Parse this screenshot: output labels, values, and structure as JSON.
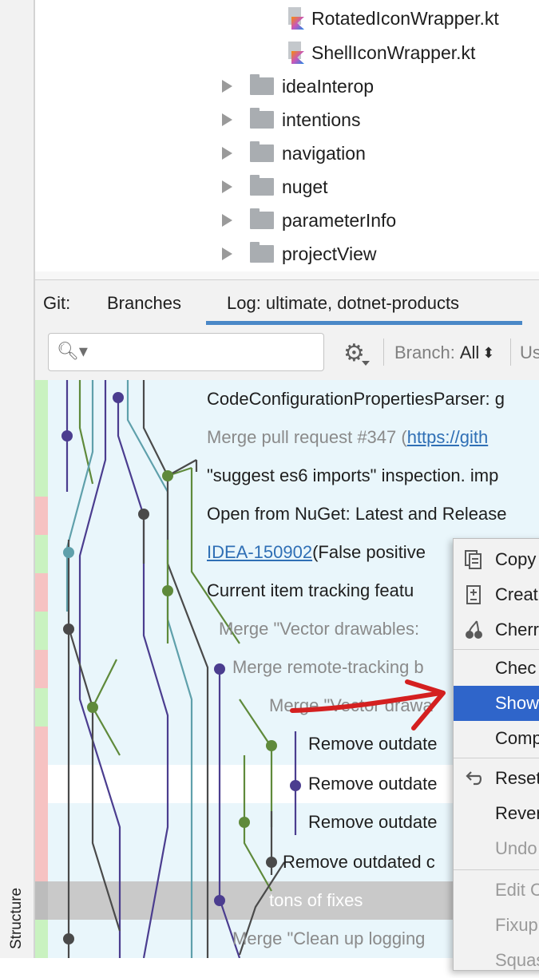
{
  "structure_label": "Structure",
  "tree": {
    "files": [
      {
        "name": "RotatedIconWrapper.kt"
      },
      {
        "name": "ShellIconWrapper.kt"
      }
    ],
    "folders": [
      {
        "name": "ideaInterop"
      },
      {
        "name": "intentions"
      },
      {
        "name": "navigation"
      },
      {
        "name": "nuget"
      },
      {
        "name": "parameterInfo"
      },
      {
        "name": "projectView"
      }
    ]
  },
  "git_tabs": {
    "prefix": "Git:",
    "branches": "Branches",
    "log": "Log: ultimate, dotnet-products"
  },
  "toolbar": {
    "search_icon": "🔍︎▾",
    "settings_icon": "⚙",
    "branch_label": "Branch:",
    "branch_value": "All",
    "branch_arrows": "⬍",
    "user_label_cut": "Us"
  },
  "commits": [
    {
      "text": "CodeConfigurationPropertiesParser: g",
      "style": "normal"
    },
    {
      "text": "Merge pull request #347 (",
      "link": "https://gith",
      "style": "muted"
    },
    {
      "text": "\"suggest es6 imports\" inspection. imp",
      "style": "normal"
    },
    {
      "text": "Open from NuGet: Latest and Release",
      "style": "normal"
    },
    {
      "link": "IDEA-150902",
      "text": " (False positive",
      "style": "normal"
    },
    {
      "text": "Current item tracking featu",
      "style": "normal"
    },
    {
      "text": "Merge \"Vector drawables: ",
      "style": "muted"
    },
    {
      "text": "Merge remote-tracking b",
      "style": "muted"
    },
    {
      "text": "Merge \"Vector drawa",
      "style": "muted"
    },
    {
      "text": "Remove outdate",
      "style": "normal"
    },
    {
      "text": "Remove outdate",
      "style": "normal"
    },
    {
      "text": "Remove outdate",
      "style": "normal"
    },
    {
      "text": "Remove outdated c",
      "style": "normal"
    },
    {
      "text": "tons of fixes",
      "style": "selected"
    },
    {
      "text": "Merge \"Clean up logging",
      "style": "muted"
    }
  ],
  "context_menu": [
    {
      "label": "Copy",
      "icon": "copy-icon"
    },
    {
      "label": "Creat",
      "icon": "create-patch-icon"
    },
    {
      "label": "Cherr",
      "icon": "cherry-pick-icon"
    },
    {
      "label": "Chec",
      "icon": ""
    },
    {
      "label": "Show",
      "icon": "",
      "selected": true
    },
    {
      "label": "Comp",
      "icon": ""
    },
    {
      "label": "Reset",
      "icon": "reset-icon"
    },
    {
      "label": "Rever",
      "icon": ""
    },
    {
      "label": "Undo",
      "icon": "",
      "disabled": true
    },
    {
      "label": "Edit C",
      "icon": "",
      "disabled": true
    },
    {
      "label": "Fixup",
      "icon": "",
      "disabled": true
    },
    {
      "label": "Squas",
      "icon": "",
      "disabled": true
    }
  ],
  "colors": {
    "selection_blue": "#2f65ca",
    "tab_underline": "#4a88c7",
    "log_background": "#e9f6fb",
    "annotation_arrow": "#d42020"
  }
}
